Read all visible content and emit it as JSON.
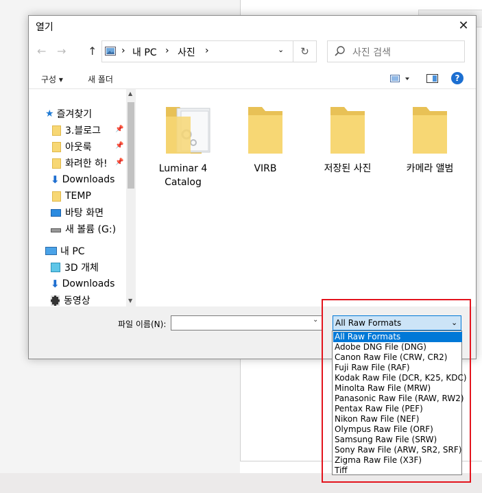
{
  "dialog": {
    "title": "열기",
    "close_glyph": "✕",
    "nav": {
      "back_glyph": "←",
      "forward_glyph": "→",
      "up_glyph": "↑"
    },
    "breadcrumb": [
      "내 PC",
      "사진"
    ],
    "refresh_glyph": "↻",
    "search_placeholder": "사진 검색",
    "toolbar": {
      "organize": "구성 ▾",
      "new_folder": "새 폴더",
      "help": "?"
    },
    "nav_items": [
      {
        "label": "즐겨찾기",
        "icon": "star-icon"
      },
      {
        "label": "3.블로그",
        "icon": "folder-icon"
      },
      {
        "label": "아웃룩",
        "icon": "folder-icon"
      },
      {
        "label": "화려한 하!",
        "icon": "folder-icon"
      },
      {
        "label": "Downloads",
        "icon": "download-icon"
      },
      {
        "label": "TEMP",
        "icon": "folder-icon"
      },
      {
        "label": "바탕 화면",
        "icon": "desktop-icon"
      },
      {
        "label": "새 볼륨 (G:)",
        "icon": "drive-icon"
      },
      {
        "label": "내 PC",
        "icon": "pc-icon"
      },
      {
        "label": "3D 개체",
        "icon": "cube-icon"
      },
      {
        "label": "Downloads",
        "icon": "download-icon"
      },
      {
        "label": "동영상",
        "icon": "video-icon"
      }
    ],
    "folders": [
      {
        "label": "Luminar 4 Catalog"
      },
      {
        "label": "VIRB"
      },
      {
        "label": "저장된 사진"
      },
      {
        "label": "카메라 앨범"
      }
    ],
    "filename_label": "파일 이름(N):",
    "filename_value": "",
    "filetype_selected": "All Raw Formats",
    "filetype_options": [
      "All Raw Formats",
      "Adobe DNG File (DNG)",
      "Canon Raw File (CRW, CR2)",
      "Fuji Raw File (RAF)",
      "Kodak Raw File (DCR, K25, KDC)",
      "Minolta Raw File (MRW)",
      "Panasonic Raw File (RAW, RW2)",
      "Pentax Raw File (PEF)",
      "Nikon Raw File (NEF)",
      "Olympus Raw File (ORF)",
      "Samsung Raw File (SRW)",
      "Sony Raw File (ARW, SR2, SRF)",
      "Zigma Raw File (X3F)",
      "Tiff"
    ]
  },
  "colors": {
    "accent": "#0078d7",
    "highlight": "#e3131c",
    "folder": "#f7d774"
  }
}
